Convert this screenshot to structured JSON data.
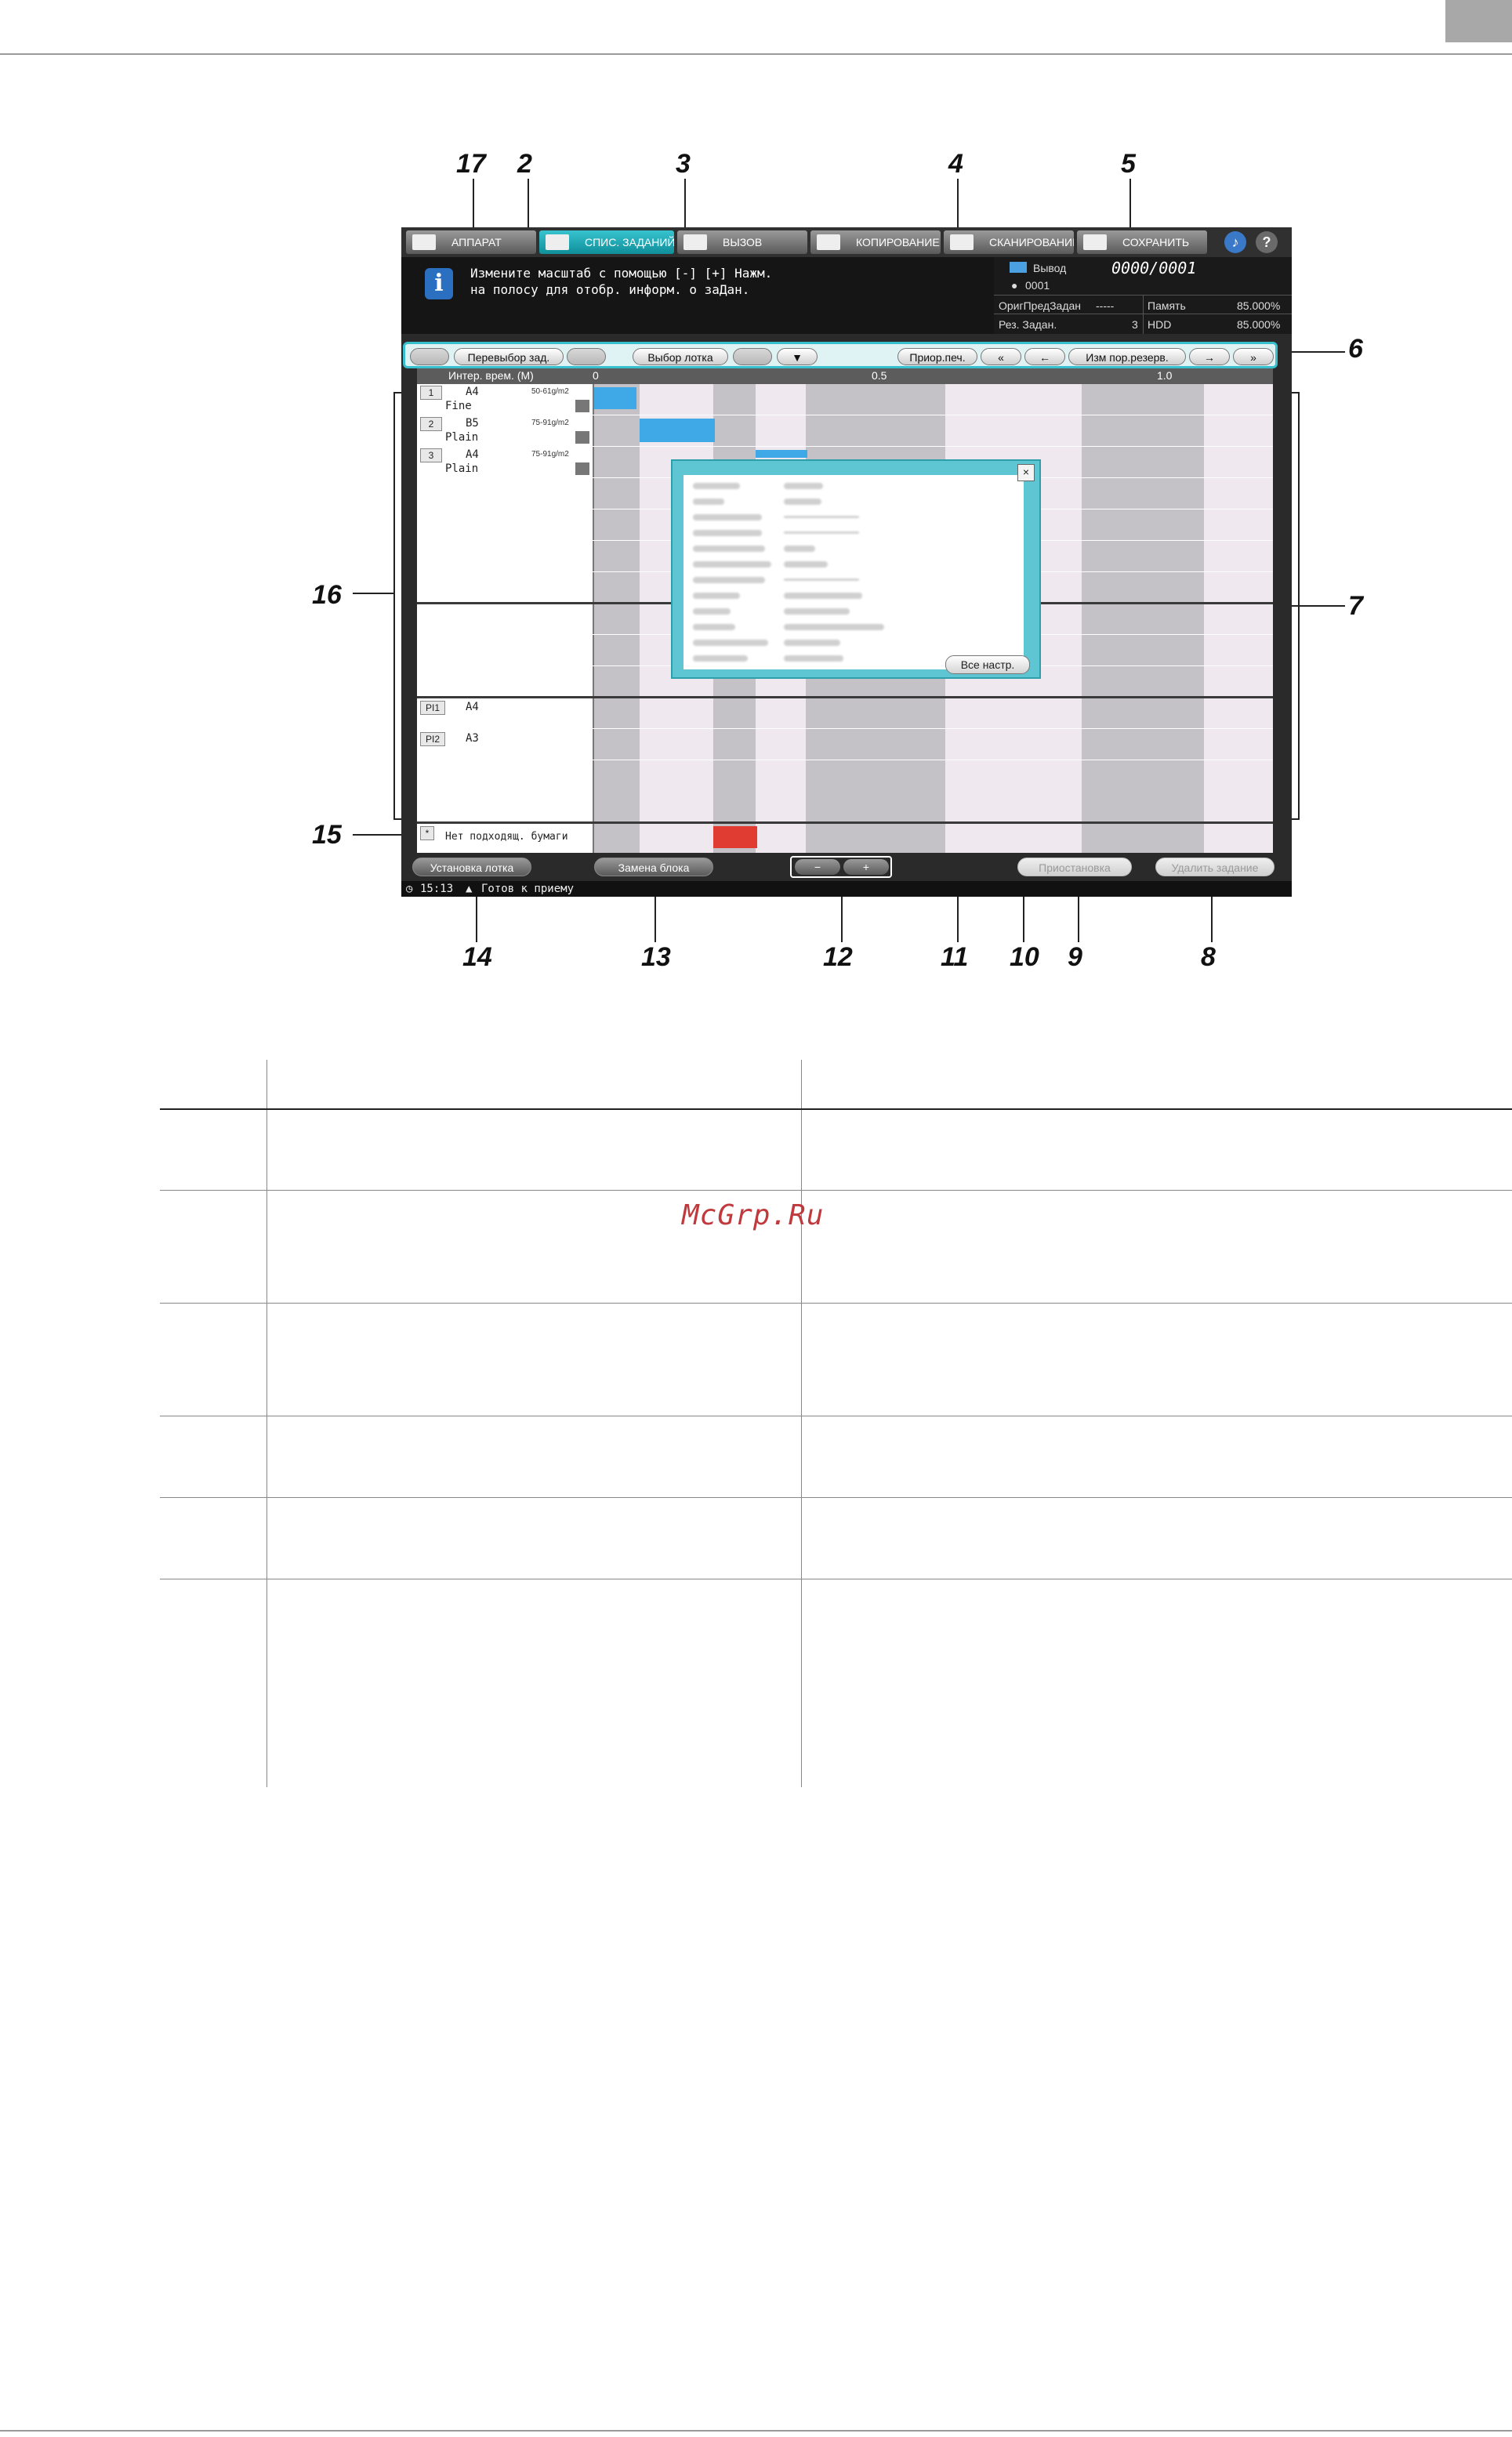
{
  "tabs": [
    "АППАРАТ",
    "СПИС. ЗАДАНИЙ",
    "ВЫЗОВ",
    "КОПИРОВАНИЕ",
    "СКАНИРОВАНИЕ",
    "СОХРАНИТЬ"
  ],
  "message": "Измените масштаб с помощью [-] [+] Нажм.\nна полосу для отобр. информ. о заДан.",
  "status_panel": {
    "output_label": "Вывод",
    "output_value": "0000/0001",
    "user_value": "0001",
    "orig_label": "ОригПредЗадан",
    "orig_value": "-----",
    "mem_label": "Память",
    "mem_value": "85.000%",
    "res_label": "Рез. Задан.",
    "res_value": "3",
    "hdd_label": "HDD",
    "hdd_value": "85.000%"
  },
  "toolbar": {
    "reselect": "Перевыбор зад.",
    "tray_select": "Выбор лотка",
    "priority": "Приор.печ.",
    "change_order": "Изм пор.резерв."
  },
  "grid": {
    "header_label": "Интер. врем. (M)",
    "scale": [
      "0",
      "0.5",
      "1.0"
    ],
    "trays": [
      {
        "no": "1",
        "size": "A4",
        "weight": "50-61g/m2",
        "type": "Fine"
      },
      {
        "no": "2",
        "size": "B5",
        "weight": "75-91g/m2",
        "type": "Plain"
      },
      {
        "no": "3",
        "size": "A4",
        "weight": "75-91g/m2",
        "type": "Plain"
      }
    ],
    "pi_trays": [
      {
        "no": "PI1",
        "size": "A4"
      },
      {
        "no": "PI2",
        "size": "A3"
      }
    ],
    "no_paper_mark": "*",
    "no_paper_label": "Нет подходящ. бумаги"
  },
  "popup": {
    "all_settings": "Все настр."
  },
  "bottom": {
    "tray_setting": "Установка лотка",
    "replace_block": "Замена блока",
    "zoom_out": "−",
    "zoom_in": "+",
    "pause": "Приостановка",
    "delete_job": "Удалить задание"
  },
  "statusbar": {
    "time": "15:13",
    "ready": "Готов к приему"
  },
  "callouts": [
    "17",
    "2",
    "3",
    "4",
    "5",
    "6",
    "7",
    "16",
    "15",
    "14",
    "13",
    "12",
    "11",
    "10",
    "9",
    "8"
  ],
  "watermark": "McGrp.Ru",
  "colors": {
    "accent": "#37bfcd",
    "job_bar": "#3fa9e8",
    "error_bar": "#e03c31",
    "info_icon": "#2b6fc0"
  }
}
